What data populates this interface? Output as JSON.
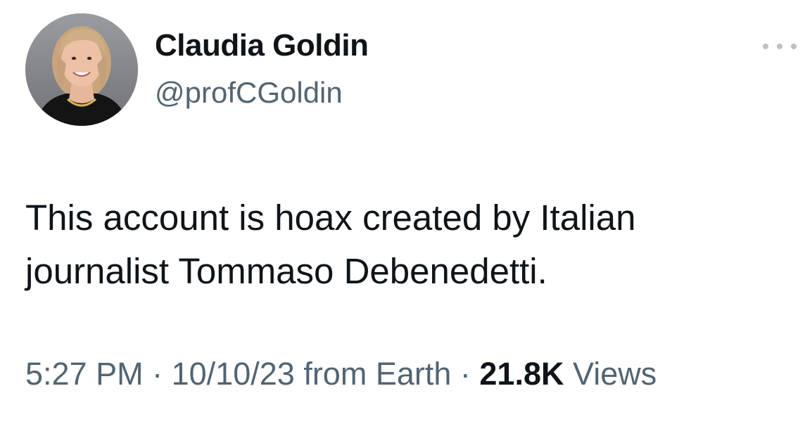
{
  "author": {
    "display_name": "Claudia Goldin",
    "handle": "@profCGoldin"
  },
  "tweet": {
    "text": "This account is hoax created by Italian journalist Tommaso Debenedetti."
  },
  "meta": {
    "time": "5:27 PM",
    "separator": "·",
    "date": "10/10/23",
    "source": "from Earth",
    "views_count": "21.8K",
    "views_label": "Views"
  },
  "icons": {
    "more": "more-horizontal-icon"
  },
  "colors": {
    "primary_text": "#0f1419",
    "secondary_text": "#536471",
    "more_dots": "#b9c1c9",
    "background": "#ffffff"
  }
}
